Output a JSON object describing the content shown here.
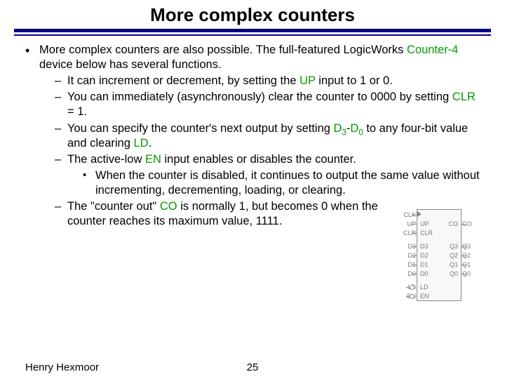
{
  "title": "More complex counters",
  "bullet_intro_a": "More complex counters are also possible. The full-featured Logic",
  "bullet_intro_b": "Works ",
  "bullet_intro_link": "Counter-4",
  "bullet_intro_c": " device below has several functions.",
  "subs": [
    {
      "pre": "It can increment or decrement, by setting the ",
      "link": "UP",
      "post": " input to 1 or 0."
    },
    {
      "pre": "You can immediately (asynchronously) clear the counter to 0000 by setting ",
      "link": "CLR",
      "post": " = 1."
    },
    {
      "pre": "You can specify the counter's next output by setting ",
      "d3": "D",
      "d3s": "3",
      "dash": "-",
      "d0": "D",
      "d0s": "0",
      "mid": " to any four-bit value and clearing ",
      "link": "LD",
      "post": "."
    },
    {
      "pre": "The active-low ",
      "link": "EN",
      "post": " input enables or disables the counter.",
      "sub2": "When the counter is disabled, it continues to output the same value without incrementing, decrementing, loading, or clearing."
    },
    {
      "pre": "The \"counter out\" ",
      "link": "CO",
      "post": " is normally 1, but becomes 0 when the counter reaches its maximum value, 1111."
    }
  ],
  "chip": {
    "left": [
      "CLK",
      "UP",
      "CLR",
      "D3",
      "D2",
      "D1",
      "D0",
      "LD",
      "EN"
    ],
    "right": [
      "",
      "CO",
      "",
      "Q3",
      "Q2",
      "Q1",
      "Q0",
      "",
      ""
    ]
  },
  "footer": {
    "author": "Henry Hexmoor",
    "page": "25"
  }
}
